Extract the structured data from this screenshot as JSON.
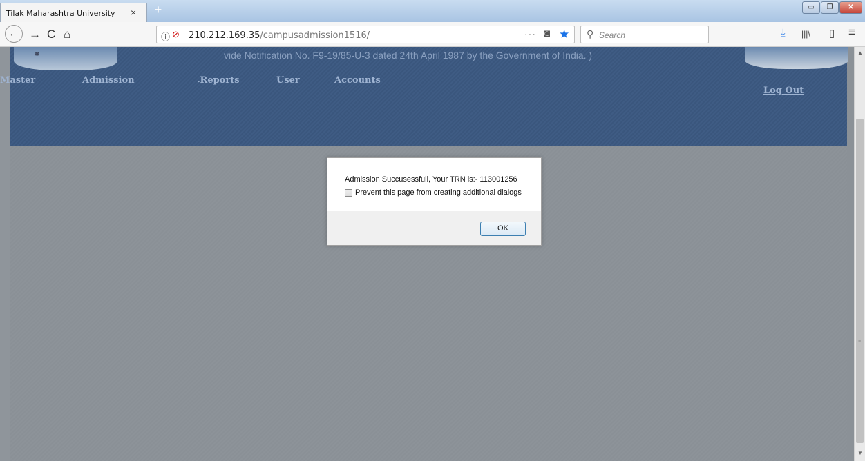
{
  "tab": {
    "title": "Tilak Maharashtra University",
    "close": "×",
    "new_tab": "+"
  },
  "window_controls": {
    "minimize": "▭",
    "maximize": "❐",
    "close": "✕"
  },
  "nav": {
    "back": "←",
    "forward": "→",
    "reload": "C",
    "home": "⌂",
    "url_host": "210.212.169.35",
    "url_path": "/campusadmission1516/",
    "url_more": "···",
    "search_placeholder": "Search"
  },
  "toolbar": {
    "download": "⤓",
    "library": "|||\\",
    "sidebar": "▯",
    "menu": "≡"
  },
  "header": {
    "notice": "vide Notification No. F9-19/85-U-3 dated 24th April 1987 by the Government of India. )",
    "menu": [
      "Master",
      "Admission",
      "Reports",
      "User",
      "Accounts"
    ],
    "logout": "Log Out"
  },
  "dialog": {
    "message": "Admission Succusessfull, Your TRN is:- 113001256",
    "checkbox_label": "Prevent this page from creating additional dialogs",
    "ok_label": "OK"
  },
  "colors": {
    "header_bg": "#3e5a82",
    "page_bg": "#8b9197",
    "accent_star": "#1a73e8"
  }
}
